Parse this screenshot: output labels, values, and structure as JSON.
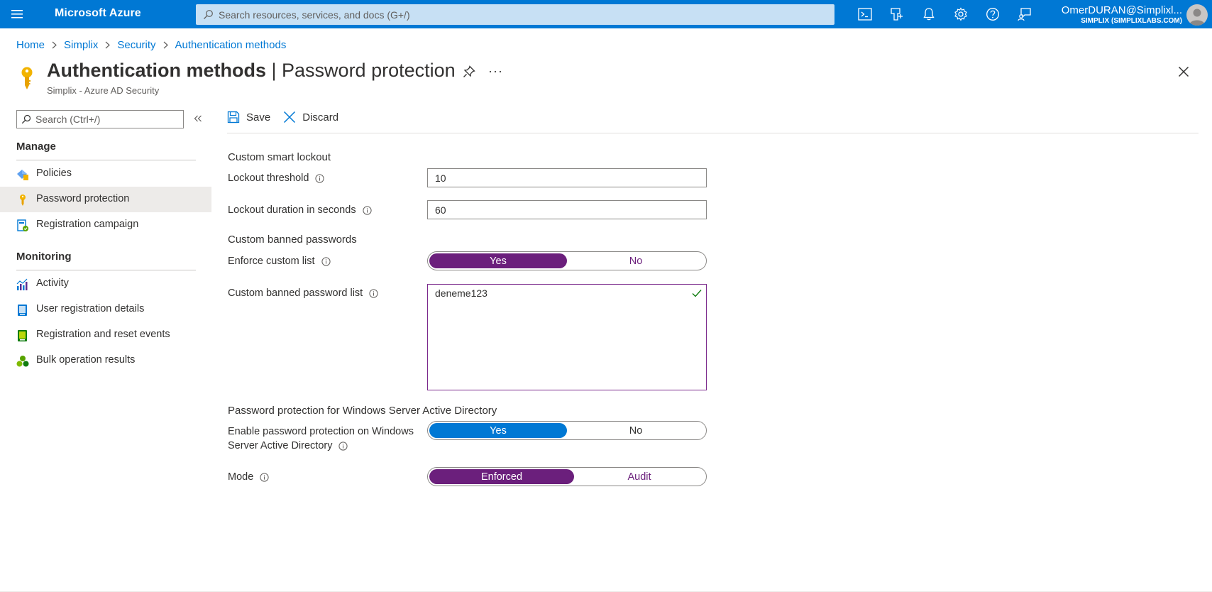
{
  "topbar": {
    "brand": "Microsoft Azure",
    "search_placeholder": "Search resources, services, and docs (G+/)",
    "icons": [
      "cloud-shell-icon",
      "directory-filter-icon",
      "notifications-icon",
      "settings-icon",
      "help-icon",
      "feedback-icon"
    ],
    "account_name": "OmerDURAN@Simplixl...",
    "account_tenant": "SIMPLIX (SIMPLIXLABS.COM)",
    "color": "#0078d4"
  },
  "breadcrumb": [
    "Home",
    "Simplix",
    "Security",
    "Authentication methods"
  ],
  "header": {
    "title_main": "Authentication methods",
    "title_sep": " | ",
    "title_page": "Password protection",
    "subtitle": "Simplix - Azure AD Security",
    "more": "···"
  },
  "nav": {
    "search_placeholder": "Search (Ctrl+/)",
    "sections": [
      {
        "title": "Manage",
        "items": [
          {
            "label": "Policies",
            "icon": "policies-icon"
          },
          {
            "label": "Password protection",
            "icon": "key-icon",
            "active": true
          },
          {
            "label": "Registration campaign",
            "icon": "registration-campaign-icon"
          }
        ]
      },
      {
        "title": "Monitoring",
        "items": [
          {
            "label": "Activity",
            "icon": "activity-icon"
          },
          {
            "label": "User registration details",
            "icon": "user-registration-icon"
          },
          {
            "label": "Registration and reset events",
            "icon": "reset-events-icon"
          },
          {
            "label": "Bulk operation results",
            "icon": "bulk-operation-icon"
          }
        ]
      }
    ]
  },
  "toolbar": {
    "save": "Save",
    "discard": "Discard"
  },
  "form": {
    "smart_lockout_heading": "Custom smart lockout",
    "lockout_threshold_label": "Lockout threshold",
    "lockout_threshold_value": "10",
    "lockout_duration_label": "Lockout duration in seconds",
    "lockout_duration_value": "60",
    "banned_heading": "Custom banned passwords",
    "enforce_label": "Enforce custom list",
    "enforce_options": [
      "Yes",
      "No"
    ],
    "enforce_selected": "Yes",
    "banned_list_label": "Custom banned password list",
    "banned_list_value": "deneme123",
    "windows_heading": "Password protection for Windows Server Active Directory",
    "enable_label_line1": "Enable password protection on Windows",
    "enable_label_line2": "Server Active Directory",
    "enable_options": [
      "Yes",
      "No"
    ],
    "enable_selected": "Yes",
    "mode_label": "Mode",
    "mode_options": [
      "Enforced",
      "Audit"
    ],
    "mode_selected": "Enforced"
  },
  "colors": {
    "accent_blue": "#0078d4",
    "accent_purple": "#6b1f7c",
    "valid_green": "#107c10"
  }
}
